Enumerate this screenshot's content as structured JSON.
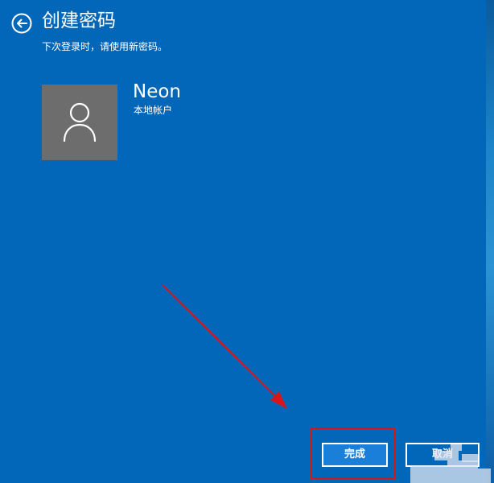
{
  "header": {
    "title": "创建密码",
    "subtitle": "下次登录时，请使用新密码。"
  },
  "account": {
    "name": "Neon",
    "type": "本地帐户"
  },
  "buttons": {
    "finish_label": "完成",
    "cancel_label": "取消"
  },
  "icons": {
    "back": "back-arrow-icon",
    "avatar": "user-silhouette-icon"
  },
  "colors": {
    "background": "#0367b9",
    "avatar_tile": "#6d6d6d",
    "primary_button": "#1a7fd9",
    "annotation": "#d9141a"
  }
}
